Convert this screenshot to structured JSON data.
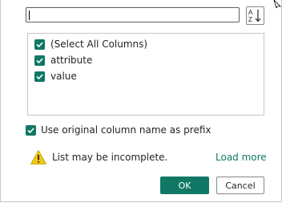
{
  "search": {
    "value": "",
    "placeholder": ""
  },
  "sort_button": {
    "icon": "sort-az-icon",
    "letters_top": "A",
    "letters_bottom": "Z"
  },
  "columns": {
    "items": [
      {
        "label": "(Select All Columns)",
        "checked": true
      },
      {
        "label": "attribute",
        "checked": true
      },
      {
        "label": "value",
        "checked": true
      }
    ]
  },
  "prefix_option": {
    "label": "Use original column name as prefix",
    "checked": true
  },
  "warning": {
    "icon": "warning-icon",
    "text": "List may be incomplete.",
    "link_label": "Load more"
  },
  "footer": {
    "ok_label": "OK",
    "cancel_label": "Cancel"
  },
  "colors": {
    "accent": "#117865",
    "warning_fill": "#f2c811",
    "border": "#c8c6c4"
  }
}
